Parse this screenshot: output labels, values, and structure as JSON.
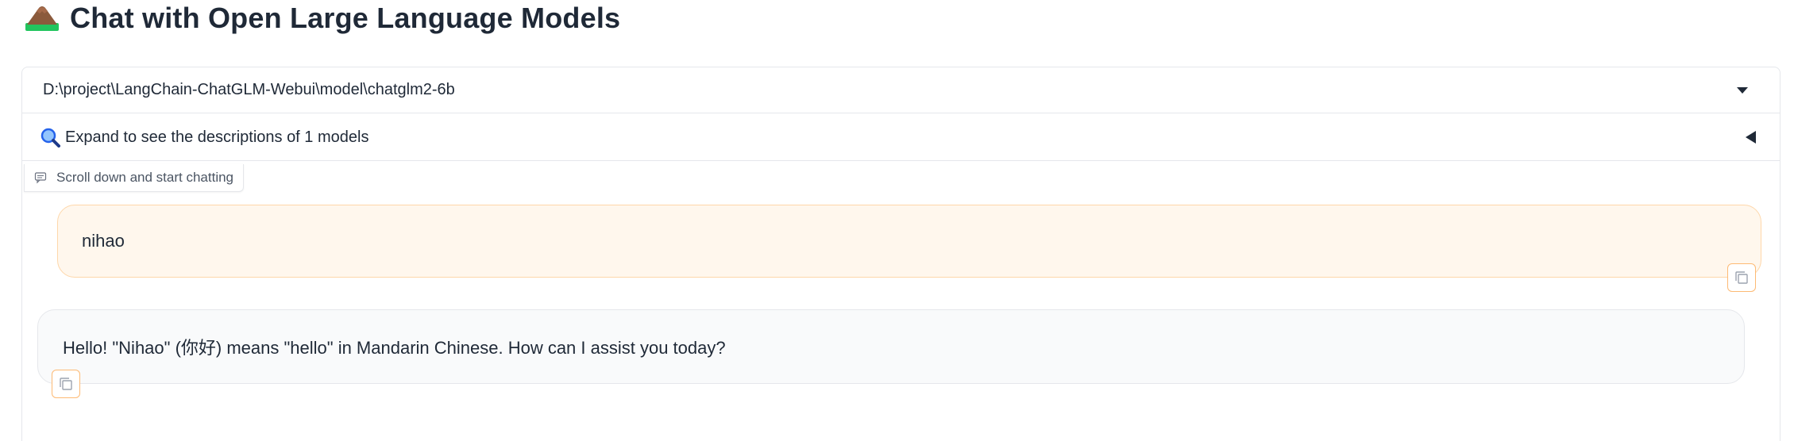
{
  "header": {
    "title": "Chat with Open Large Language Models",
    "logo_icon": "mountain-icon"
  },
  "model_select": {
    "value": "D:\\project\\LangChain-ChatGLM-Webui\\model\\chatglm2-6b",
    "icon": "caret-down-icon"
  },
  "accordion": {
    "label": "Expand to see the descriptions of 1 models",
    "icon": "magnifier-icon",
    "toggle_icon": "caret-left-icon"
  },
  "chatbot": {
    "label": "Scroll down and start chatting",
    "label_icon": "chat-icon",
    "messages": [
      {
        "role": "user",
        "text": "nihao"
      },
      {
        "role": "bot",
        "text": "Hello! \"Nihao\" (你好) means \"hello\" in Mandarin Chinese. How can I assist you today?"
      }
    ],
    "copy_icon": "copy-icon"
  },
  "colors": {
    "user_bubble_bg": "#fff7ed",
    "user_bubble_border": "#fed7aa",
    "bot_bubble_bg": "#f9fafb",
    "accent": "#fdba74",
    "text": "#1f2937"
  }
}
